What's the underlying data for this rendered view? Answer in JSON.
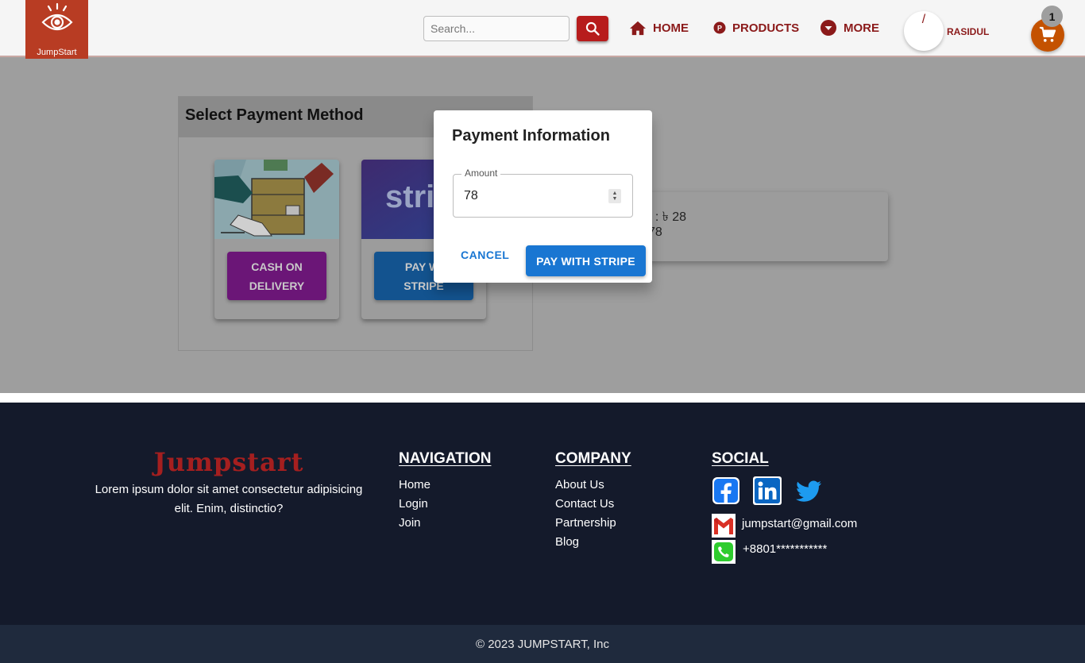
{
  "header": {
    "logo_text": "JumpStart",
    "search_placeholder": "Search...",
    "nav": {
      "home": "HOME",
      "products": "PRODUCTS",
      "more": "MORE"
    },
    "avatar_text": "/",
    "username": "RASIDUL",
    "cart_count": "1"
  },
  "payment": {
    "title": "Select Payment Method",
    "cod_label_1": "CASH ON",
    "cod_label_2": "DELIVERY",
    "stripe_label_1": "PAY WI",
    "stripe_label_2": "STRIPE",
    "stripe_logo": "strip"
  },
  "summary": {
    "line1": "t : ৳ 28",
    "line2": "78"
  },
  "dialog": {
    "title": "Payment Information",
    "amount_label": "Amount",
    "amount_value": "78",
    "cancel": "CANCEL",
    "pay": "PAY WITH STRIPE"
  },
  "footer": {
    "brand": "Jumpstart",
    "description": "Lorem ipsum dolor sit amet consectetur adipisicing elit. Enim, distinctio?",
    "navigation": {
      "heading": "NAVIGATION",
      "links": [
        "Home",
        "Login",
        "Join"
      ]
    },
    "company": {
      "heading": "COMPANY",
      "links": [
        "About Us",
        "Contact Us",
        "Partnership",
        "Blog"
      ]
    },
    "social": {
      "heading": "SOCIAL",
      "email": "jumpstart@gmail.com",
      "phone": "+8801***********",
      "icons": [
        "facebook-icon",
        "linkedin-icon",
        "twitter-icon"
      ]
    }
  },
  "copyright": "© 2023 JUMPSTART, Inc",
  "colors": {
    "brand_red": "#b71c1c",
    "primary_blue": "#1976d2",
    "footer_bg": "#141a2b",
    "cod_purple": "#9c27b0",
    "cart_orange": "#e65c00"
  }
}
